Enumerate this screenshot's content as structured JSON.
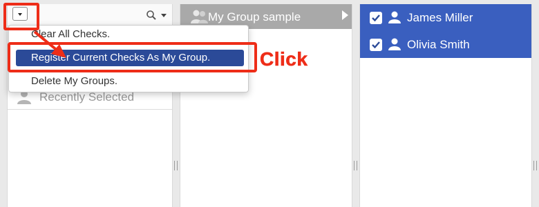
{
  "search": {
    "value": "",
    "placeholder": ""
  },
  "left_panel": {
    "recent_label": "Recently Selected"
  },
  "menu": {
    "items": [
      {
        "label": "Clear All Checks."
      },
      {
        "label": "Register Current Checks As My Group."
      },
      {
        "label": "Delete My Groups."
      }
    ]
  },
  "middle_panel": {
    "group_title": "My Group sample"
  },
  "right_panel": {
    "selected": [
      {
        "name": "James Miller",
        "checked": true
      },
      {
        "name": "Olivia Smith",
        "checked": true
      }
    ]
  },
  "annotation": {
    "click_label": "Click",
    "color": "#ee2d18"
  },
  "colors": {
    "menu_active": "#2b4a98",
    "selected_bg": "#3a5fbf",
    "group_header_bg": "#a9a9a9"
  },
  "icons": [
    "chevron-down-icon",
    "search-icon",
    "group-icon",
    "person-icon",
    "check-icon",
    "chevron-right-icon"
  ]
}
